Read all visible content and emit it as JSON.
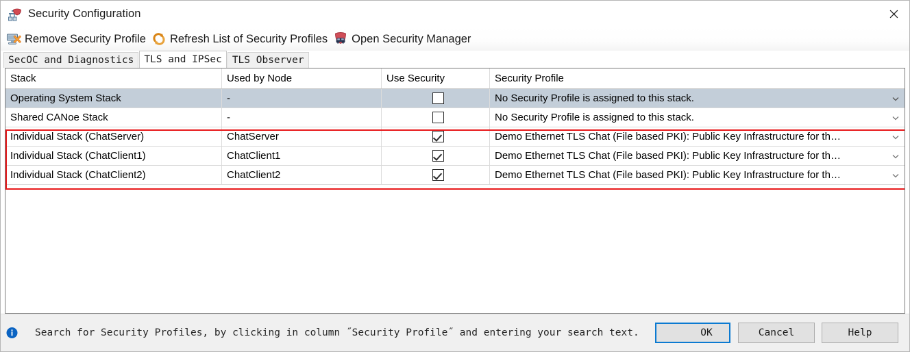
{
  "window": {
    "title": "Security Configuration",
    "title_icon": "security-config-icon",
    "close_label": "✕"
  },
  "toolbar": {
    "items": [
      {
        "label": "Remove Security Profile",
        "icon": "remove-security-profile-icon"
      },
      {
        "label": "Refresh List of Security Profiles",
        "icon": "refresh-icon"
      },
      {
        "label": "Open Security Manager",
        "icon": "security-manager-icon"
      }
    ]
  },
  "tabs": [
    {
      "label": "SecOC and Diagnostics",
      "active": false
    },
    {
      "label": "TLS and IPSec",
      "active": true
    },
    {
      "label": "TLS Observer",
      "active": false
    }
  ],
  "table": {
    "columns": [
      "Stack",
      "Used by Node",
      "Use Security",
      "Security Profile"
    ],
    "rows": [
      {
        "stack": "Operating System Stack",
        "node": "-",
        "use_security": false,
        "profile": "No Security Profile is assigned to this stack.",
        "selected": true,
        "highlighted": false
      },
      {
        "stack": "Shared CANoe Stack",
        "node": "-",
        "use_security": false,
        "profile": "No Security Profile is assigned to this stack.",
        "selected": false,
        "highlighted": false
      },
      {
        "stack": "Individual Stack (ChatServer)",
        "node": "ChatServer",
        "use_security": true,
        "profile": "Demo Ethernet TLS Chat (File based PKI): Public Key Infrastructure for th…",
        "selected": false,
        "highlighted": true
      },
      {
        "stack": "Individual Stack (ChatClient1)",
        "node": "ChatClient1",
        "use_security": true,
        "profile": "Demo Ethernet TLS Chat (File based PKI): Public Key Infrastructure for th…",
        "selected": false,
        "highlighted": true
      },
      {
        "stack": "Individual Stack (ChatClient2)",
        "node": "ChatClient2",
        "use_security": true,
        "profile": "Demo Ethernet TLS Chat (File based PKI): Public Key Infrastructure for th…",
        "selected": false,
        "highlighted": true
      }
    ]
  },
  "footer": {
    "info_icon": "info-icon",
    "status_text": "Search for Security Profiles, by clicking in column ˝Security Profile˝ and entering your search text.",
    "buttons": {
      "ok": "OK",
      "cancel": "Cancel",
      "help": "Help"
    }
  },
  "colors": {
    "selection": "#c3ced9",
    "highlight_box": "#e8191b",
    "focus_border": "#0b7ad1",
    "footer_bg": "#f0f0f0"
  }
}
